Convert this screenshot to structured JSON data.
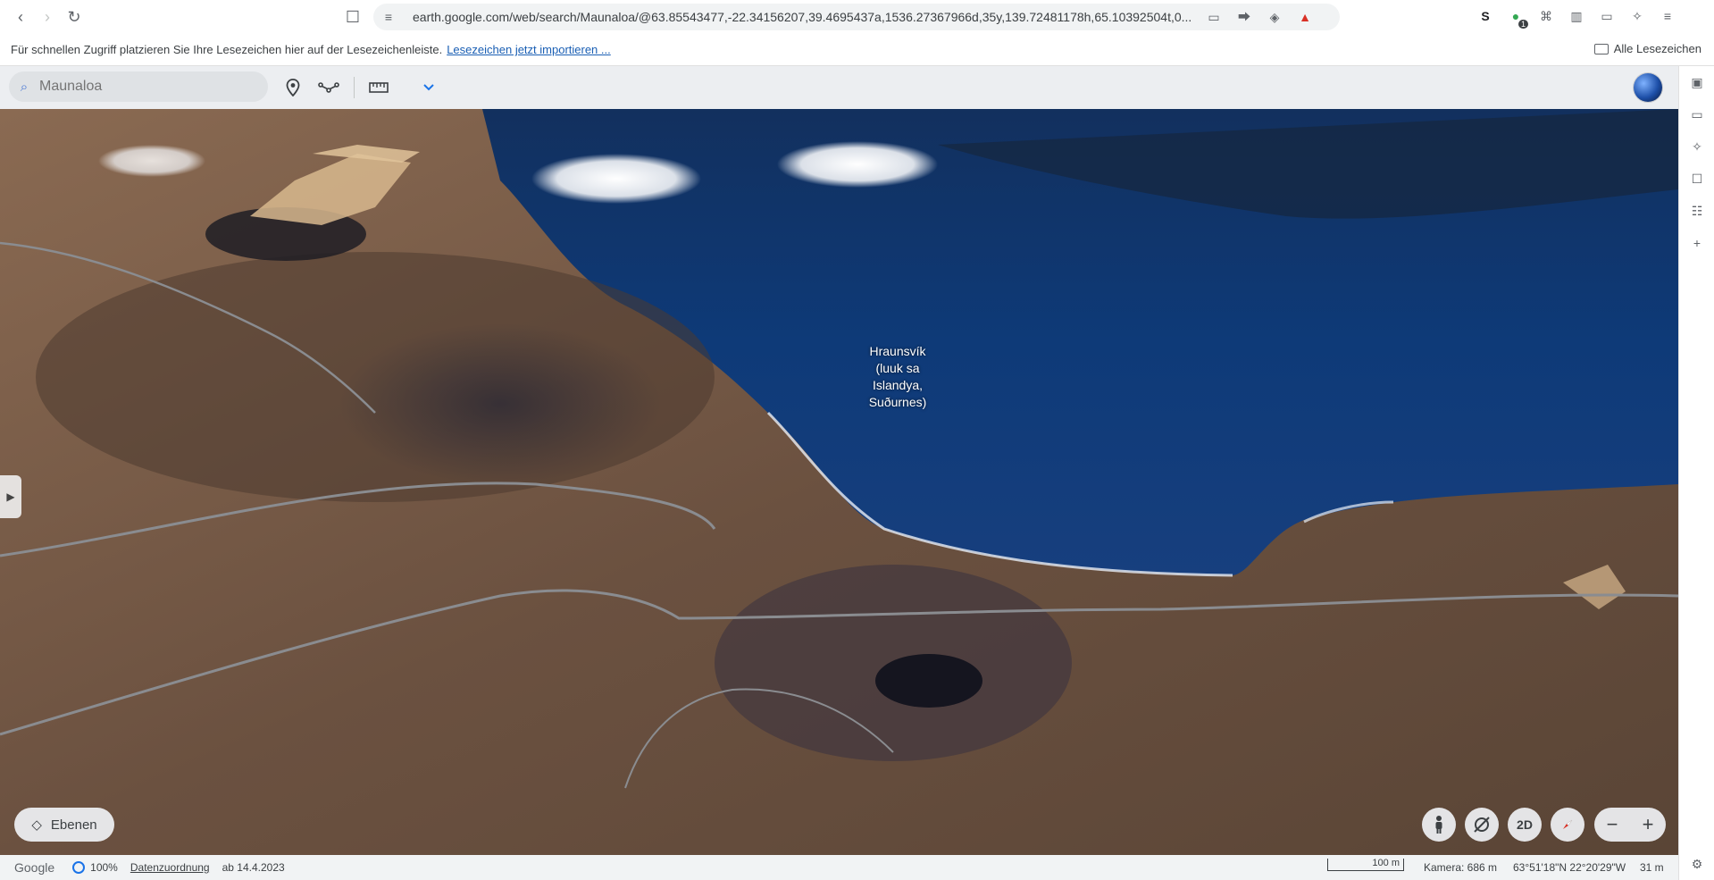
{
  "browser": {
    "url": "earth.google.com/web/search/Maunaloa/@63.85543477,-22.34156207,39.4695437a,1536.27367966d,35y,139.72481178h,65.10392504t,0...",
    "badge_count": "1",
    "ext_s_label": "S"
  },
  "bookmarks": {
    "hint": "Für schnellen Zugriff platzieren Sie Ihre Lesezeichen hier auf der Lesezeichenleiste.",
    "import_link": "Lesezeichen jetzt importieren ...",
    "all_label": "Alle Lesezeichen"
  },
  "earth": {
    "search_placeholder": "Maunaloa",
    "place_label": [
      "Hraunsvík",
      "(luuk sa",
      "Islandya,",
      "Suðurnes)"
    ],
    "layers_label": "Ebenen",
    "mode_2d": "2D"
  },
  "status": {
    "logo": "Google",
    "percent": "100%",
    "attribution": "Datenzuordnung",
    "date": "ab 14.4.2023",
    "scale_label": "100 m",
    "camera": "Kamera: 686 m",
    "coords": "63°51'18\"N 22°20'29\"W",
    "altitude": "31 m"
  },
  "colors": {
    "accent": "#1a73e8",
    "sea": "#0e3a78",
    "land": "#6b5140"
  }
}
